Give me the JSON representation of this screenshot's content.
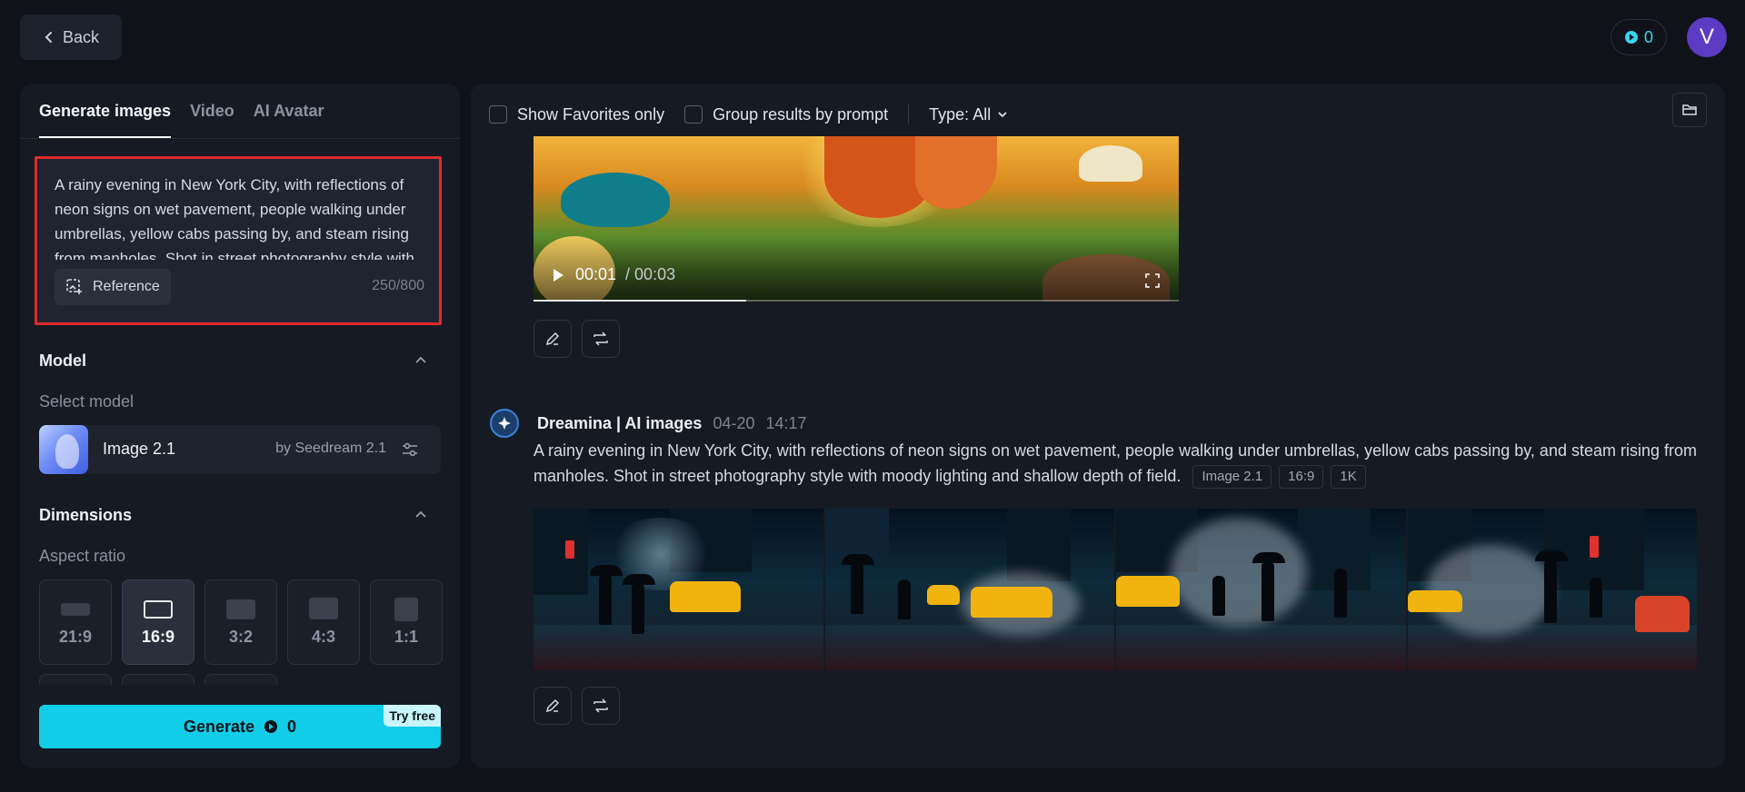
{
  "header": {
    "back_label": "Back",
    "credits": "0",
    "avatar_initial": "V"
  },
  "tabs": [
    {
      "label": "Generate images",
      "active": true
    },
    {
      "label": "Video",
      "active": false
    },
    {
      "label": "AI Avatar",
      "active": false
    }
  ],
  "prompt": {
    "text": "A rainy evening in New York City, with reflections of neon signs on wet pavement, people walking under umbrellas, yellow cabs passing by, and steam rising from manholes. Shot in street photography style with moody lighting and shallow depth of field.",
    "reference_label": "Reference",
    "char_count": "250/800"
  },
  "model": {
    "section_title": "Model",
    "select_label": "Select model",
    "name": "Image 2.1",
    "by": "by Seedream 2.1"
  },
  "dimensions": {
    "section_title": "Dimensions",
    "aspect_label": "Aspect ratio",
    "ratios": [
      {
        "label": "21:9",
        "active": false
      },
      {
        "label": "16:9",
        "active": true
      },
      {
        "label": "3:2",
        "active": false
      },
      {
        "label": "4:3",
        "active": false
      },
      {
        "label": "1:1",
        "active": false
      }
    ]
  },
  "generate": {
    "label": "Generate",
    "cost": "0",
    "badge": "Try free"
  },
  "filters": {
    "favorites_label": "Show Favorites only",
    "group_label": "Group results by prompt",
    "type_label": "Type: All"
  },
  "video": {
    "current_time": "00:01",
    "duration": "/ 00:03",
    "progress": 0.33
  },
  "generation": {
    "source": "Dreamina | AI images",
    "date": "04-20",
    "time": "14:17",
    "prompt": "A rainy evening in New York City, with reflections of neon signs on wet pavement, people walking under umbrellas, yellow cabs passing by, and steam rising from manholes. Shot in street photography style with moody lighting and shallow depth of field.",
    "tags": [
      "Image 2.1",
      "16:9",
      "1K"
    ]
  },
  "colors": {
    "accent": "#11cde8",
    "highlight_border": "#e02a2a",
    "avatar": "#5b3bc4"
  }
}
